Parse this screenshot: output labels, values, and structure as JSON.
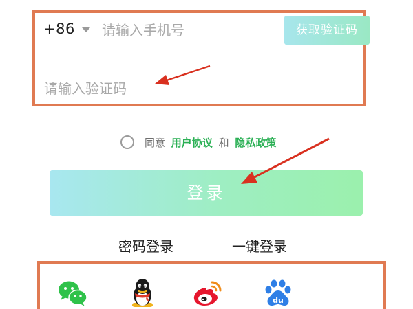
{
  "login_form": {
    "country_code": "+86",
    "phone_placeholder": "请输入手机号",
    "get_code_label": "获取验证码",
    "code_placeholder": "请输入验证码"
  },
  "agreement": {
    "agree_text": "同意",
    "user_agreement": "用户协议",
    "and_text": "和",
    "privacy_policy": "隐私政策"
  },
  "login_button": {
    "label": "登录"
  },
  "alt_login": {
    "password_login": "密码登录",
    "onekey_login": "一键登录"
  },
  "social_login": {
    "icons": [
      "wechat-icon",
      "qq-icon",
      "weibo-icon",
      "baidu-icon"
    ]
  },
  "colors": {
    "highlight_border": "#e07a52",
    "accent_green": "#2bb055",
    "arrow_red": "#d9301f"
  }
}
